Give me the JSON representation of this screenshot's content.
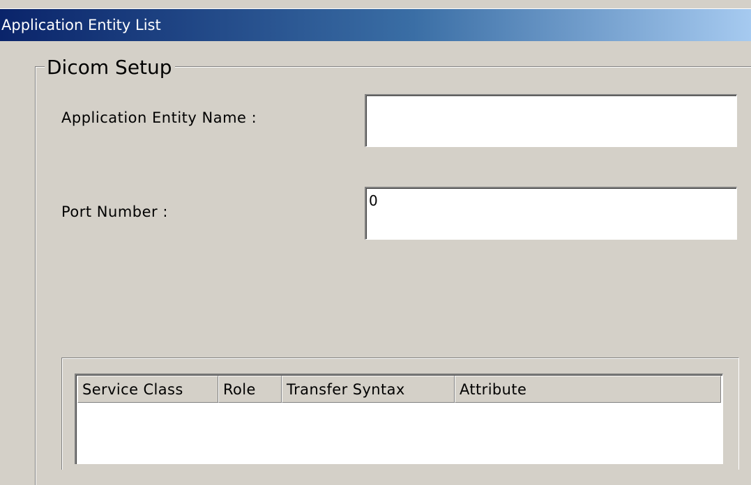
{
  "window": {
    "title": "Application Entity List"
  },
  "dicom_setup": {
    "group_label": "Dicom Setup",
    "ae_name": {
      "label": "Application  Entity Name :",
      "value": ""
    },
    "port_number": {
      "label": "Port Number :",
      "value": "0"
    }
  },
  "service_list": {
    "columns": [
      {
        "label": "Service Class"
      },
      {
        "label": "Role"
      },
      {
        "label": "Transfer Syntax"
      },
      {
        "label": "Attribute"
      }
    ],
    "rows": []
  },
  "colors": {
    "titlebar_start": "#0a246a",
    "titlebar_end": "#a6caf0",
    "window_face": "#d4d0c8",
    "field_background": "#ffffff"
  }
}
